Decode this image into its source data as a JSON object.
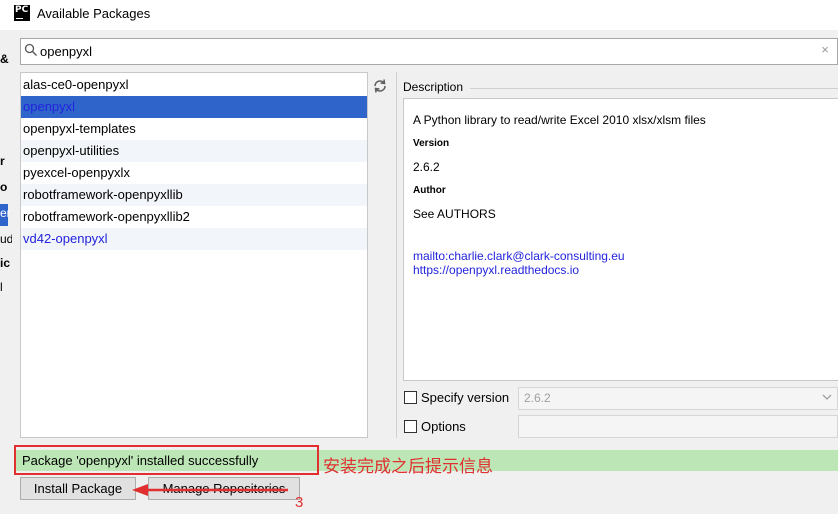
{
  "window": {
    "app_icon_text": "PC",
    "title": "Available Packages"
  },
  "left_strip_chars": [
    "&",
    "r",
    "o",
    "er",
    "ud",
    "ic",
    "l"
  ],
  "search": {
    "value": "openpyxl",
    "placeholder": ""
  },
  "packages": [
    {
      "name": "alas-ce0-openpyxl"
    },
    {
      "name": "openpyxl"
    },
    {
      "name": "openpyxl-templates"
    },
    {
      "name": "openpyxl-utilities"
    },
    {
      "name": "pyexcel-openpyxlx"
    },
    {
      "name": "robotframework-openpyxllib"
    },
    {
      "name": "robotframework-openpyxllib2"
    },
    {
      "name": "vd42-openpyxl"
    }
  ],
  "selected_package_index": 1,
  "description": {
    "header": "Description",
    "summary": "A Python library to read/write Excel 2010 xlsx/xlsm files",
    "version_label": "Version",
    "version": "2.6.2",
    "author_label": "Author",
    "author": "See AUTHORS",
    "link_mail": "mailto:charlie.clark@clark-consulting.eu",
    "link_docs": "https://openpyxl.readthedocs.io"
  },
  "options": {
    "specify_version_label": "Specify version",
    "specify_version_value": "2.6.2",
    "options_label": "Options"
  },
  "status": {
    "message": "Package 'openpyxl' installed successfully",
    "annotation": "安装完成之后提示信息",
    "step_number": "3"
  },
  "buttons": {
    "install": "Install Package",
    "manage_repositories": "Manage Repositories"
  },
  "colors": {
    "selection": "#2f65ca",
    "link": "#2323dc",
    "status_bg": "#bde6b6",
    "annotation_red": "#e03030"
  }
}
